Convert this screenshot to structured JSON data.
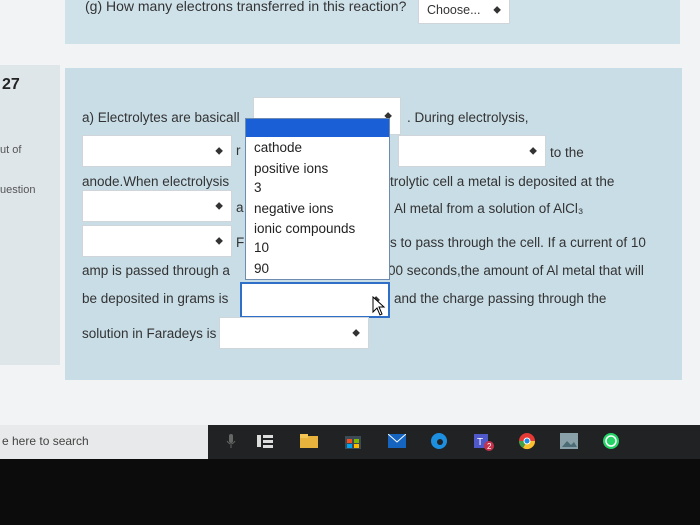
{
  "top_question": {
    "label": "(g) How many electrons transferred in this reaction?",
    "select_value": "Choose..."
  },
  "sidebar": {
    "question_number": "27",
    "out_of": "ut of",
    "question": "uestion"
  },
  "question": {
    "line1_a": "a) Electrolytes are basicall",
    "line1_b": ". During electrolysis,",
    "line2_partial": "r",
    "line2_end": "to the",
    "line3_a": "anode.When electrolysis",
    "line3_b": "trolytic cell a metal is deposited at the",
    "line4_partial": "a",
    "line4_b": "Al metal from a solution of AlCl₃",
    "line5_partial": "F",
    "line5_b": "s to pass through the cell. If a current of 10",
    "line6_a": "amp is passed through a",
    "line6_b": "00 seconds,the amount of Al metal that will",
    "line7_a": "be deposited in grams is",
    "line7_b": "and the charge passing through the",
    "line8_a": "solution in Faradeys is"
  },
  "dropdown": {
    "options": [
      "cathode",
      "positive ions",
      "3",
      "negative ions",
      "ionic compounds",
      "10",
      "90"
    ]
  },
  "taskbar": {
    "search_placeholder": "e here to search"
  }
}
